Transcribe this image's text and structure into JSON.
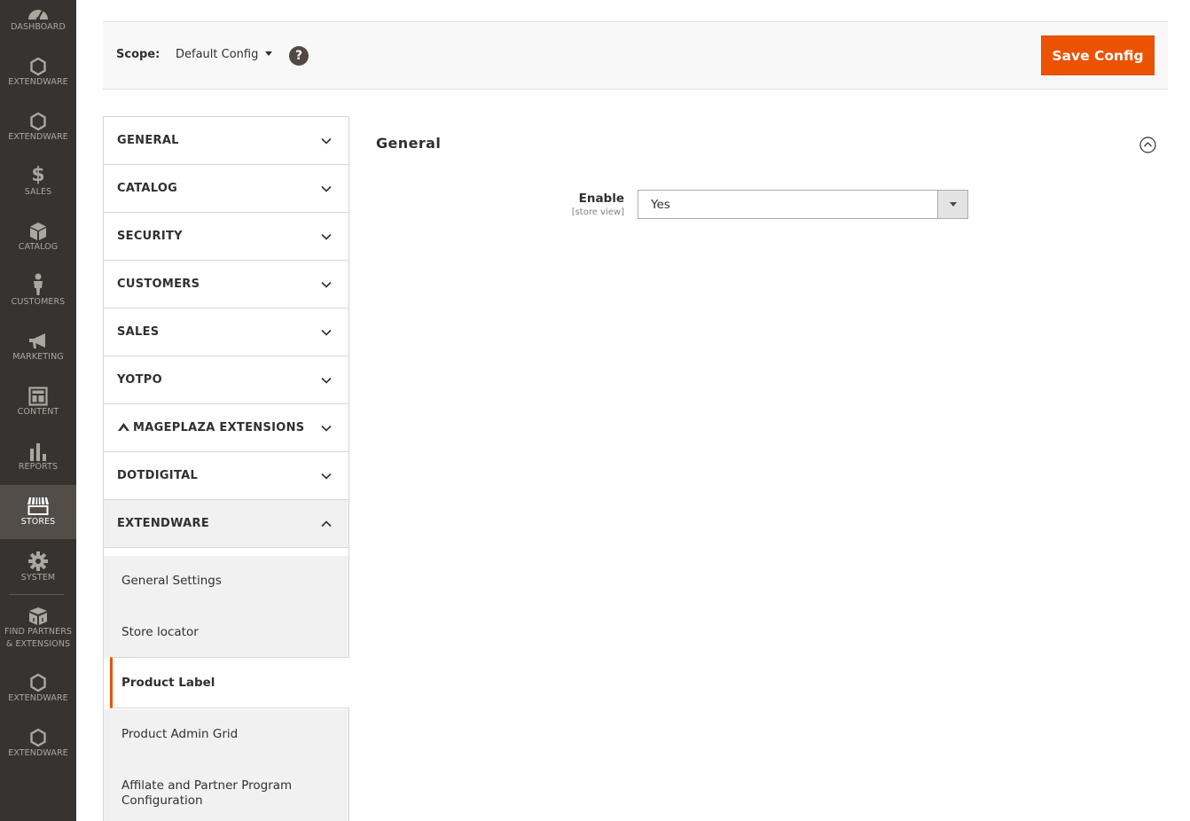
{
  "admin_menu": {
    "items": [
      {
        "label": "DASHBOARD",
        "icon": "dashboard-icon"
      },
      {
        "label": "EXTENDWARE",
        "icon": "hexagon-icon"
      },
      {
        "label": "EXTENDWARE",
        "icon": "hexagon-icon"
      },
      {
        "label": "SALES",
        "icon": "dollar-icon"
      },
      {
        "label": "CATALOG",
        "icon": "cube-icon"
      },
      {
        "label": "CUSTOMERS",
        "icon": "person-icon"
      },
      {
        "label": "MARKETING",
        "icon": "megaphone-icon"
      },
      {
        "label": "CONTENT",
        "icon": "layout-icon"
      },
      {
        "label": "REPORTS",
        "icon": "bar-chart-icon"
      },
      {
        "label": "STORES",
        "icon": "storefront-icon",
        "active": true
      },
      {
        "label": "SYSTEM",
        "icon": "gear-icon"
      },
      {
        "label": "FIND PARTNERS",
        "label2": "& EXTENSIONS",
        "icon": "boxes-icon"
      },
      {
        "label": "EXTENDWARE",
        "icon": "hexagon-icon"
      },
      {
        "label": "EXTENDWARE",
        "icon": "hexagon-icon"
      }
    ]
  },
  "scope": {
    "label": "Scope:",
    "value": "Default Config",
    "help": "?"
  },
  "actions": {
    "save_label": "Save Config"
  },
  "config_tabs": {
    "sections": [
      {
        "label": "GENERAL",
        "open": false
      },
      {
        "label": "CATALOG",
        "open": false
      },
      {
        "label": "SECURITY",
        "open": false
      },
      {
        "label": "CUSTOMERS",
        "open": false
      },
      {
        "label": "SALES",
        "open": false
      },
      {
        "label": "YOTPO",
        "open": false
      },
      {
        "label": "MAGEPLAZA EXTENSIONS",
        "open": false,
        "icon": "mageplaza-logo-icon"
      },
      {
        "label": "DOTDIGITAL",
        "open": false
      },
      {
        "label": "EXTENDWARE",
        "open": true
      }
    ],
    "extendware_items": [
      {
        "label": "General Settings"
      },
      {
        "label": "Store locator"
      },
      {
        "label": "Product Label",
        "current": true
      },
      {
        "label": "Product Admin Grid"
      },
      {
        "label": "Affilate and Partner Program",
        "label2": "Configuration"
      }
    ]
  },
  "section": {
    "title": "General",
    "fields": [
      {
        "label": "Enable",
        "scope": "[store view]",
        "value": "Yes"
      }
    ]
  },
  "colors": {
    "menu_bg": "#373330",
    "menu_active_bg": "#524d49",
    "accent": "#eb5202"
  }
}
